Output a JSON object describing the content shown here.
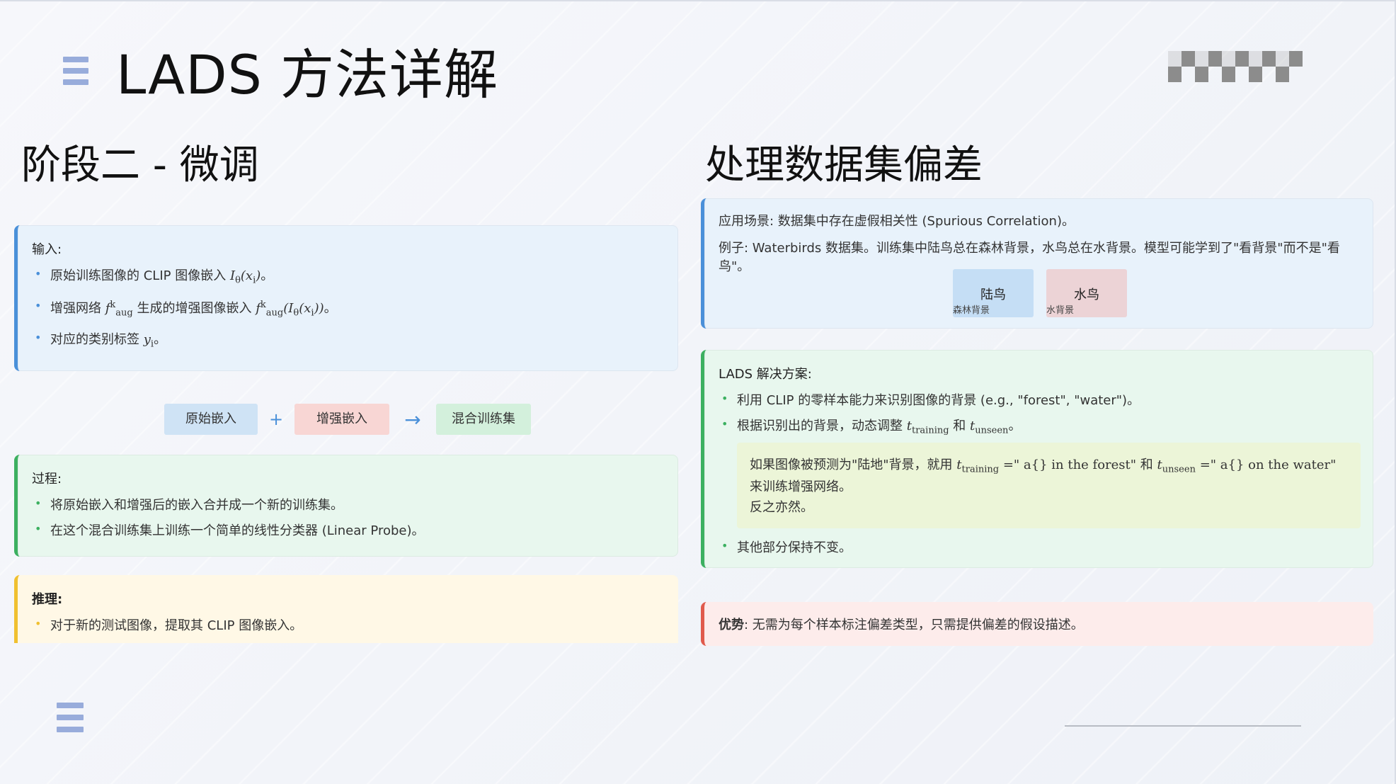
{
  "title": "LADS 方法详解",
  "left": {
    "title": "阶段二 - 微调",
    "input": {
      "head": "输入:",
      "item1_text": "原始训练图像的 CLIP 图像嵌入",
      "item2_text_a": "增强网络",
      "item2_text_b": "生成的增强图像嵌入",
      "item3_text": "对应的类别标签"
    },
    "flow": {
      "box1": "原始嵌入",
      "plus": "+",
      "box2": "增强嵌入",
      "arrow": "→",
      "box3": "混合训练集"
    },
    "process": {
      "head": "过程:",
      "items": [
        "将原始嵌入和增强后的嵌入合并成一个新的训练集。",
        "在这个混合训练集上训练一个简单的线性分类器 (Linear Probe)。"
      ]
    },
    "inference": {
      "head": "推理:",
      "items": [
        "对于新的测试图像，提取其 CLIP 图像嵌入。"
      ]
    }
  },
  "right": {
    "title": "处理数据集偏差",
    "scenario": {
      "line1": "应用场景: 数据集中存在虚假相关性 (Spurious Correlation)。",
      "line2": "例子: Waterbirds 数据集。训练集中陆鸟总在森林背景，水鸟总在水背景。模型可能学到了\"看背景\"而不是\"看鸟\"。",
      "land_bird": "陆鸟",
      "land_bg": "森林背景",
      "water_bird": "水鸟",
      "water_bg": "水背景"
    },
    "solution": {
      "head": "LADS 解决方案:",
      "item1": "利用 CLIP 的零样本能力来识别图像的背景 (e.g., \"forest\", \"water\")。",
      "item2_a": "根据识别出的背景，动态调整",
      "item2_and": "和",
      "inner_a": "如果图像被预测为\"陆地\"背景，就用",
      "inner_eq1": "=\" a{} in the forest\"",
      "inner_and": "和",
      "inner_eq2": "=\" a{} on the water\"",
      "inner_b": "来训练增强网络。",
      "inner_c": "反之亦然。",
      "item3": "其他部分保持不变。"
    },
    "advantage": {
      "label": "优势",
      "text": ": 无需为每个样本标注偏差类型，只需提供偏差的假设描述。"
    }
  }
}
